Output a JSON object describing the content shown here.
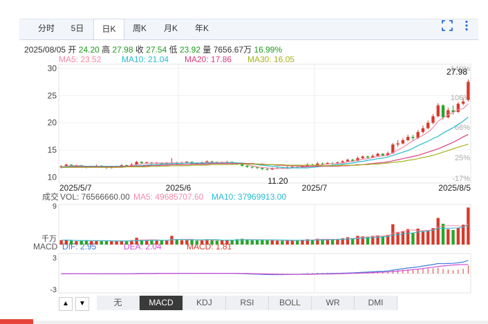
{
  "tabs": [
    {
      "label": "分时",
      "active": false
    },
    {
      "label": "5日",
      "active": false
    },
    {
      "label": "日K",
      "active": true
    },
    {
      "label": "周K",
      "active": false
    },
    {
      "label": "月K",
      "active": false
    },
    {
      "label": "年K",
      "active": false
    }
  ],
  "info": {
    "date": "2025/08/05",
    "open_label": "开",
    "open": "24.20",
    "high_label": "高",
    "high": "27.98",
    "close_label": "收",
    "close": "27.54",
    "low_label": "低",
    "low": "23.92",
    "volume_label": "量",
    "volume": "7656.67万",
    "change": "16.99%"
  },
  "ma_legend": [
    {
      "text": "MA5: 23.52",
      "color": "#f08aa8"
    },
    {
      "text": "MA10: 21.04",
      "color": "#22bcd0"
    },
    {
      "text": "MA20: 17.86",
      "color": "#d93a7a"
    },
    {
      "text": "MA30: 16.05",
      "color": "#a4b21c"
    }
  ],
  "vol_legend": [
    {
      "text": "成交",
      "color": "#555"
    },
    {
      "text": "VOL: 76566660.00",
      "color": "#555"
    },
    {
      "text": "MA5: 49685707.60",
      "color": "#f08aa8"
    },
    {
      "text": "MA10: 37969913.00",
      "color": "#22bcd0"
    }
  ],
  "macd_legend": [
    {
      "text": "MACD",
      "color": "#555"
    },
    {
      "text": "DIF: 2.95",
      "color": "#3a7ad8"
    },
    {
      "text": "DEA: 2.04",
      "color": "#d24bd4"
    },
    {
      "text": "MACD: 1.81",
      "color": "#d23b2e"
    }
  ],
  "indicator_tabs": [
    {
      "label": "无",
      "active": false
    },
    {
      "label": "MACD",
      "active": true
    },
    {
      "label": "KDJ",
      "active": false
    },
    {
      "label": "RSI",
      "active": false
    },
    {
      "label": "BOLL",
      "active": false
    },
    {
      "label": "WR",
      "active": false
    },
    {
      "label": "DMI",
      "active": false
    }
  ],
  "nav": {
    "up": "▲",
    "down": "▼"
  },
  "chart_data": {
    "type": "candlestick",
    "x_ticks": [
      "2025/5/7",
      "2025/6",
      "2025/7",
      "2025/8/5"
    ],
    "y_ticks": [
      10,
      15,
      20,
      25,
      30
    ],
    "ylim": [
      9.8,
      30
    ],
    "pct_ticks": [
      "140%",
      "106%",
      "66%",
      "25%",
      "-17%"
    ],
    "max_label": "27.98",
    "min_label": "11.20",
    "vol_y_ticks": [
      "9",
      "千万"
    ],
    "macd_y_ticks": [
      "3",
      "-3"
    ],
    "candles": [
      [
        11.8,
        12.0,
        12.2,
        11.6
      ],
      [
        12.0,
        12.3,
        12.5,
        11.9
      ],
      [
        12.3,
        12.1,
        12.4,
        12.0
      ],
      [
        12.1,
        12.2,
        12.3,
        11.9
      ],
      [
        12.2,
        12.0,
        12.3,
        11.8
      ],
      [
        12.0,
        11.8,
        12.1,
        11.6
      ],
      [
        11.8,
        11.9,
        12.1,
        11.7
      ],
      [
        11.9,
        12.1,
        12.3,
        11.8
      ],
      [
        12.1,
        11.9,
        12.2,
        11.7
      ],
      [
        11.9,
        11.7,
        12.0,
        11.5
      ],
      [
        11.7,
        11.8,
        12.0,
        11.6
      ],
      [
        11.8,
        12.0,
        12.1,
        11.7
      ],
      [
        12.0,
        12.2,
        12.4,
        11.9
      ],
      [
        12.2,
        12.1,
        12.3,
        11.9
      ],
      [
        12.1,
        12.3,
        12.6,
        12.0
      ],
      [
        12.3,
        12.8,
        13.0,
        12.2
      ],
      [
        12.8,
        12.6,
        12.9,
        12.4
      ],
      [
        12.6,
        12.7,
        12.9,
        12.5
      ],
      [
        12.7,
        12.5,
        12.8,
        12.3
      ],
      [
        12.5,
        12.6,
        12.8,
        12.4
      ],
      [
        12.6,
        12.4,
        12.7,
        12.2
      ],
      [
        12.4,
        12.6,
        12.8,
        12.3
      ],
      [
        12.6,
        12.7,
        13.5,
        12.5
      ],
      [
        12.7,
        12.5,
        12.8,
        12.3
      ],
      [
        12.5,
        12.6,
        12.9,
        12.4
      ],
      [
        12.6,
        12.8,
        13.0,
        12.5
      ],
      [
        12.8,
        12.6,
        12.9,
        12.4
      ],
      [
        12.6,
        12.5,
        12.7,
        12.3
      ],
      [
        12.5,
        12.7,
        12.9,
        12.4
      ],
      [
        12.7,
        12.9,
        13.1,
        12.6
      ],
      [
        12.9,
        12.8,
        13.0,
        12.6
      ],
      [
        12.8,
        12.6,
        12.9,
        12.5
      ],
      [
        12.6,
        12.7,
        12.9,
        12.5
      ],
      [
        12.7,
        12.8,
        13.0,
        12.6
      ],
      [
        12.8,
        12.6,
        12.9,
        12.4
      ],
      [
        12.6,
        12.4,
        12.7,
        12.2
      ],
      [
        12.4,
        12.1,
        12.5,
        11.9
      ],
      [
        12.1,
        11.9,
        12.2,
        11.7
      ],
      [
        11.9,
        11.8,
        12.0,
        11.6
      ],
      [
        11.8,
        11.7,
        11.9,
        11.5
      ],
      [
        11.7,
        11.5,
        11.8,
        11.3
      ],
      [
        11.5,
        11.4,
        11.6,
        11.2
      ],
      [
        11.4,
        11.6,
        11.8,
        11.3
      ],
      [
        11.6,
        11.7,
        11.9,
        11.5
      ],
      [
        11.7,
        11.6,
        11.9,
        11.5
      ],
      [
        11.6,
        11.8,
        12.0,
        11.5
      ],
      [
        11.8,
        11.9,
        12.1,
        11.7
      ],
      [
        11.9,
        11.8,
        12.0,
        11.6
      ],
      [
        11.8,
        12.0,
        12.2,
        11.7
      ],
      [
        12.0,
        12.3,
        12.6,
        11.9
      ],
      [
        12.3,
        12.2,
        12.5,
        12.0
      ],
      [
        12.2,
        12.5,
        12.8,
        12.1
      ],
      [
        12.5,
        12.4,
        12.7,
        12.2
      ],
      [
        12.4,
        12.6,
        12.8,
        12.3
      ],
      [
        12.6,
        12.5,
        12.8,
        12.3
      ],
      [
        12.5,
        12.7,
        12.9,
        12.4
      ],
      [
        12.7,
        12.9,
        13.1,
        12.6
      ],
      [
        12.9,
        13.2,
        13.4,
        12.8
      ],
      [
        13.2,
        13.0,
        13.4,
        12.8
      ],
      [
        13.0,
        13.5,
        13.8,
        12.9
      ],
      [
        13.5,
        13.8,
        14.0,
        13.3
      ],
      [
        13.8,
        13.6,
        14.0,
        13.4
      ],
      [
        13.6,
        13.9,
        14.2,
        13.5
      ],
      [
        13.9,
        14.3,
        14.5,
        13.8
      ],
      [
        14.3,
        14.0,
        14.4,
        13.8
      ],
      [
        14.0,
        14.4,
        14.7,
        13.9
      ],
      [
        14.4,
        16.0,
        16.3,
        14.3
      ],
      [
        16.0,
        16.2,
        16.8,
        15.6
      ],
      [
        16.2,
        16.8,
        17.2,
        16.0
      ],
      [
        16.8,
        17.4,
        17.8,
        16.6
      ],
      [
        17.4,
        17.2,
        17.8,
        16.8
      ],
      [
        17.2,
        18.3,
        18.7,
        17.0
      ],
      [
        18.3,
        19.0,
        19.5,
        18.0
      ],
      [
        19.0,
        20.0,
        20.4,
        18.8
      ],
      [
        20.0,
        21.2,
        21.6,
        19.7
      ],
      [
        21.2,
        23.2,
        23.6,
        21.0
      ],
      [
        23.2,
        21.0,
        23.4,
        20.6
      ],
      [
        21.0,
        22.3,
        22.8,
        20.8
      ],
      [
        22.3,
        22.0,
        23.2,
        21.5
      ],
      [
        22.0,
        23.5,
        23.8,
        21.8
      ],
      [
        23.5,
        23.9,
        24.5,
        23.2
      ],
      [
        24.2,
        27.54,
        27.98,
        23.92
      ]
    ],
    "ma_series": [
      {
        "name": "MA5",
        "color": "#f08aa8",
        "values": [
          11.9,
          12.0,
          12.1,
          12.1,
          12.1,
          12.0,
          12.0,
          12.0,
          11.9,
          11.9,
          11.9,
          11.9,
          12.0,
          12.0,
          12.1,
          12.3,
          12.4,
          12.5,
          12.6,
          12.6,
          12.6,
          12.6,
          12.6,
          12.6,
          12.6,
          12.6,
          12.6,
          12.6,
          12.6,
          12.7,
          12.7,
          12.7,
          12.7,
          12.7,
          12.7,
          12.6,
          12.5,
          12.3,
          12.1,
          11.9,
          11.8,
          11.7,
          11.6,
          11.6,
          11.6,
          11.6,
          11.7,
          11.8,
          11.8,
          11.9,
          12.0,
          12.1,
          12.3,
          12.4,
          12.5,
          12.5,
          12.6,
          12.8,
          12.9,
          13.1,
          13.3,
          13.4,
          13.6,
          13.8,
          13.9,
          14.0,
          14.5,
          15.0,
          15.5,
          16.1,
          16.7,
          17.2,
          17.7,
          18.3,
          19.1,
          20.3,
          20.9,
          21.5,
          21.9,
          22.4,
          22.6,
          23.52
        ]
      },
      {
        "name": "MA10",
        "color": "#22bcd0",
        "values": [
          11.9,
          11.9,
          12.0,
          12.0,
          12.0,
          12.0,
          12.0,
          12.0,
          12.0,
          12.0,
          12.0,
          12.0,
          12.0,
          12.0,
          12.0,
          12.1,
          12.1,
          12.2,
          12.3,
          12.3,
          12.4,
          12.4,
          12.5,
          12.5,
          12.5,
          12.6,
          12.6,
          12.6,
          12.6,
          12.6,
          12.6,
          12.6,
          12.6,
          12.6,
          12.7,
          12.6,
          12.6,
          12.5,
          12.4,
          12.3,
          12.2,
          12.1,
          12.0,
          11.9,
          11.8,
          11.7,
          11.7,
          11.7,
          11.7,
          11.7,
          11.8,
          11.9,
          12.0,
          12.1,
          12.2,
          12.3,
          12.4,
          12.5,
          12.6,
          12.8,
          12.9,
          13.1,
          13.2,
          13.4,
          13.5,
          13.7,
          14.0,
          14.3,
          14.6,
          14.9,
          15.3,
          15.8,
          16.2,
          16.6,
          17.1,
          17.5,
          18.1,
          18.6,
          19.1,
          19.7,
          20.3,
          21.04
        ]
      },
      {
        "name": "MA20",
        "color": "#d93a7a",
        "values": [
          11.8,
          11.8,
          11.9,
          11.9,
          11.9,
          11.9,
          11.9,
          11.9,
          11.9,
          11.9,
          11.9,
          11.9,
          11.9,
          12.0,
          12.0,
          12.0,
          12.0,
          12.1,
          12.1,
          12.1,
          12.2,
          12.2,
          12.3,
          12.3,
          12.3,
          12.3,
          12.4,
          12.4,
          12.4,
          12.4,
          12.5,
          12.5,
          12.5,
          12.5,
          12.5,
          12.5,
          12.5,
          12.5,
          12.5,
          12.4,
          12.4,
          12.3,
          12.3,
          12.2,
          12.2,
          12.1,
          12.1,
          12.1,
          12.0,
          12.0,
          12.0,
          12.0,
          12.0,
          12.0,
          12.0,
          12.0,
          12.1,
          12.1,
          12.2,
          12.3,
          12.3,
          12.4,
          12.5,
          12.6,
          12.7,
          12.8,
          13.0,
          13.2,
          13.4,
          13.6,
          13.8,
          14.0,
          14.3,
          14.6,
          14.9,
          15.2,
          15.6,
          16.0,
          16.4,
          16.9,
          17.4,
          17.86
        ]
      },
      {
        "name": "MA30",
        "color": "#a4b21c",
        "values": [
          11.8,
          11.8,
          11.8,
          11.8,
          11.8,
          11.8,
          11.8,
          11.8,
          11.8,
          11.8,
          11.8,
          11.8,
          11.8,
          11.9,
          11.9,
          11.9,
          11.9,
          11.9,
          12.0,
          12.0,
          12.0,
          12.0,
          12.1,
          12.1,
          12.1,
          12.1,
          12.2,
          12.2,
          12.2,
          12.2,
          12.3,
          12.3,
          12.3,
          12.3,
          12.3,
          12.4,
          12.4,
          12.4,
          12.4,
          12.4,
          12.3,
          12.3,
          12.3,
          12.3,
          12.3,
          12.2,
          12.2,
          12.2,
          12.2,
          12.2,
          12.2,
          12.2,
          12.1,
          12.1,
          12.1,
          12.1,
          12.2,
          12.2,
          12.2,
          12.2,
          12.3,
          12.3,
          12.4,
          12.4,
          12.5,
          12.6,
          12.7,
          12.8,
          12.9,
          13.1,
          13.2,
          13.4,
          13.6,
          13.8,
          14.0,
          14.3,
          14.6,
          14.9,
          15.2,
          15.5,
          15.8,
          16.05
        ]
      }
    ],
    "volume": [
      0.9,
      1.0,
      0.8,
      0.7,
      0.8,
      0.9,
      0.7,
      0.8,
      0.7,
      0.8,
      0.7,
      0.7,
      0.8,
      0.7,
      0.9,
      1.4,
      1.0,
      0.8,
      0.9,
      0.8,
      0.9,
      0.8,
      1.8,
      1.0,
      0.9,
      0.9,
      1.0,
      0.8,
      0.9,
      1.1,
      0.9,
      0.8,
      0.9,
      0.9,
      1.0,
      1.1,
      1.2,
      1.0,
      0.9,
      0.9,
      1.0,
      0.9,
      0.9,
      0.8,
      0.8,
      0.9,
      0.8,
      0.9,
      1.0,
      1.1,
      1.0,
      1.2,
      1.1,
      1.1,
      1.0,
      1.1,
      1.3,
      1.5,
      1.3,
      1.8,
      1.7,
      1.6,
      1.8,
      1.9,
      1.7,
      2.0,
      4.2,
      2.6,
      2.8,
      3.2,
      2.4,
      3.3,
      2.8,
      3.0,
      3.4,
      5.5,
      4.3,
      3.2,
      3.0,
      3.5,
      4.1,
      7.66
    ],
    "macd_dif": [
      -0.05,
      -0.04,
      -0.03,
      -0.03,
      -0.03,
      -0.04,
      -0.04,
      -0.04,
      -0.05,
      -0.06,
      -0.06,
      -0.06,
      -0.05,
      -0.05,
      -0.04,
      0.0,
      0.02,
      0.03,
      0.03,
      0.04,
      0.03,
      0.04,
      0.05,
      0.05,
      0.05,
      0.06,
      0.05,
      0.04,
      0.05,
      0.06,
      0.06,
      0.05,
      0.05,
      0.05,
      0.04,
      0.02,
      -0.02,
      -0.06,
      -0.1,
      -0.14,
      -0.18,
      -0.22,
      -0.23,
      -0.23,
      -0.23,
      -0.21,
      -0.19,
      -0.18,
      -0.15,
      -0.11,
      -0.09,
      -0.05,
      -0.03,
      0.0,
      0.01,
      0.04,
      0.08,
      0.13,
      0.15,
      0.22,
      0.3,
      0.34,
      0.4,
      0.48,
      0.5,
      0.58,
      0.77,
      0.92,
      1.08,
      1.24,
      1.33,
      1.5,
      1.67,
      1.84,
      2.0,
      2.25,
      2.2,
      2.25,
      2.28,
      2.42,
      2.55,
      2.95
    ],
    "macd_dea": [
      -0.03,
      -0.03,
      -0.03,
      -0.03,
      -0.03,
      -0.03,
      -0.03,
      -0.04,
      -0.04,
      -0.04,
      -0.04,
      -0.05,
      -0.05,
      -0.05,
      -0.05,
      -0.04,
      -0.03,
      -0.02,
      -0.01,
      0.0,
      0.01,
      0.01,
      0.02,
      0.03,
      0.03,
      0.04,
      0.04,
      0.04,
      0.04,
      0.05,
      0.05,
      0.05,
      0.05,
      0.05,
      0.05,
      0.04,
      0.03,
      0.01,
      -0.01,
      -0.04,
      -0.07,
      -0.1,
      -0.13,
      -0.15,
      -0.17,
      -0.18,
      -0.18,
      -0.18,
      -0.18,
      -0.17,
      -0.15,
      -0.13,
      -0.11,
      -0.09,
      -0.07,
      -0.05,
      -0.02,
      0.01,
      0.04,
      0.08,
      0.12,
      0.16,
      0.21,
      0.26,
      0.31,
      0.36,
      0.44,
      0.54,
      0.65,
      0.76,
      0.87,
      0.99,
      1.13,
      1.27,
      1.41,
      1.58,
      1.7,
      1.8,
      1.9,
      1.98,
      2.0,
      2.04
    ]
  }
}
